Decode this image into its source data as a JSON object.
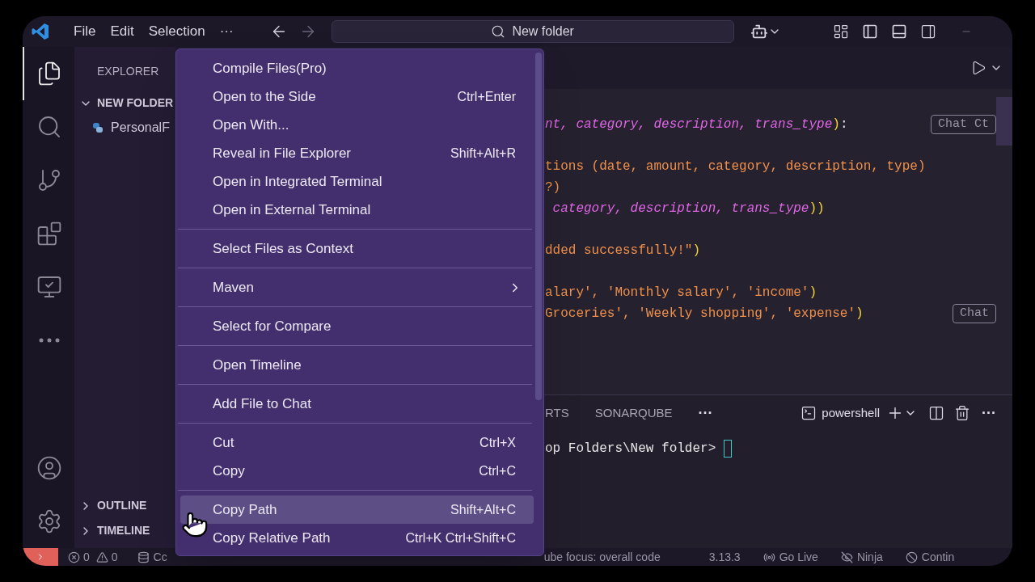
{
  "title_bar": {
    "menus": [
      "File",
      "Edit",
      "Selection",
      "···"
    ],
    "search": "New folder"
  },
  "activity_bar": [
    {
      "kind": "explorer",
      "selected": true
    },
    {
      "kind": "search",
      "selected": false
    },
    {
      "kind": "source_control",
      "selected": false
    },
    {
      "kind": "extensions",
      "selected": false
    },
    {
      "kind": "remote",
      "selected": false
    },
    {
      "kind": "more",
      "selected": false
    },
    {
      "kind": "account",
      "selected": false
    },
    {
      "kind": "settings",
      "selected": false
    }
  ],
  "sidebar": {
    "title": "EXPLORER",
    "folder": {
      "label": "NEW FOLDER",
      "expanded": true,
      "files": [
        "PersonalF"
      ]
    },
    "sections": [
      {
        "label": "OUTLINE",
        "expanded": false
      },
      {
        "label": "TIMELINE",
        "expanded": false
      }
    ]
  },
  "editor": {
    "blocks": [
      [
        {
          "tokens": [
            {
              "text": "nt, category, description, trans_type",
              "kind": "param"
            },
            {
              "text": ")",
              "kind": "bracket"
            },
            {
              "text": ":",
              "kind": "plain"
            }
          ],
          "hint": "Chat Ct"
        }
      ],
      [
        {
          "tokens": [
            {
              "text": "tions (date, amount, category, description, type)",
              "kind": "string"
            }
          ]
        },
        {
          "tokens": [
            {
              "text": "?)",
              "kind": "string"
            }
          ]
        },
        {
          "tokens": [
            {
              "text": " category, description, trans_type",
              "kind": "param"
            },
            {
              "text": "))",
              "kind": "bracket"
            }
          ]
        }
      ],
      [
        {
          "tokens": [
            {
              "text": "dded successfully!\"",
              "kind": "string"
            },
            {
              "text": ")",
              "kind": "bracket"
            }
          ]
        }
      ],
      [
        {
          "tokens": [
            {
              "text": "alary', 'Monthly salary', 'income'",
              "kind": "string"
            },
            {
              "text": ")",
              "kind": "bracket"
            }
          ]
        },
        {
          "tokens": [
            {
              "text": "Groceries', 'Weekly shopping', 'expense'",
              "kind": "string"
            },
            {
              "text": ")",
              "kind": "bracket"
            }
          ],
          "hint": "Chat"
        }
      ]
    ]
  },
  "context_menu": {
    "groups": [
      [
        {
          "label": "Compile Files(Pro)",
          "kind": "command",
          "selected": false
        },
        {
          "label": "Open to the Side",
          "shortcut": "Ctrl+Enter",
          "kind": "command",
          "selected": false
        },
        {
          "label": "Open With...",
          "kind": "command",
          "selected": false
        },
        {
          "label": "Reveal in File Explorer",
          "shortcut": "Shift+Alt+R",
          "kind": "command",
          "selected": false
        },
        {
          "label": "Open in Integrated Terminal",
          "kind": "command",
          "selected": false
        },
        {
          "label": "Open in External Terminal",
          "kind": "command",
          "selected": false
        }
      ],
      [
        {
          "label": "Select Files as Context",
          "kind": "command",
          "selected": false
        }
      ],
      [
        {
          "label": "Maven",
          "kind": "submenu",
          "selected": false
        }
      ],
      [
        {
          "label": "Select for Compare",
          "kind": "command",
          "selected": false
        }
      ],
      [
        {
          "label": "Open Timeline",
          "kind": "command",
          "selected": false
        }
      ],
      [
        {
          "label": "Add File to Chat",
          "kind": "command",
          "selected": false
        }
      ],
      [
        {
          "label": "Cut",
          "shortcut": "Ctrl+X",
          "kind": "command",
          "selected": false
        },
        {
          "label": "Copy",
          "shortcut": "Ctrl+C",
          "kind": "command",
          "selected": false
        }
      ],
      [
        {
          "label": "Copy Path",
          "shortcut": "Shift+Alt+C",
          "kind": "command",
          "selected": true
        },
        {
          "label": "Copy Relative Path",
          "shortcut": "Ctrl+K Ctrl+Shift+C",
          "kind": "command",
          "selected": false
        }
      ]
    ]
  },
  "panel": {
    "tabs": [
      {
        "label": "RTS",
        "selected": false
      },
      {
        "label": "SONARQUBE",
        "selected": false
      }
    ],
    "more": "···",
    "terminal": {
      "name": "powershell",
      "more": "···",
      "prompt": "op Folders\\New folder>"
    }
  },
  "status_bar": {
    "errors": "0",
    "warnings": "0",
    "items": [
      {
        "text": "Cc",
        "kind": "database"
      },
      {
        "text": "ube focus: overall code",
        "kind": "plain"
      },
      {
        "text": "3.13.3",
        "kind": "plain"
      },
      {
        "text": "Go Live",
        "kind": "broadcast"
      },
      {
        "text": "Ninja",
        "kind": "eye_off"
      },
      {
        "text": "Contin",
        "kind": "ban"
      }
    ]
  }
}
